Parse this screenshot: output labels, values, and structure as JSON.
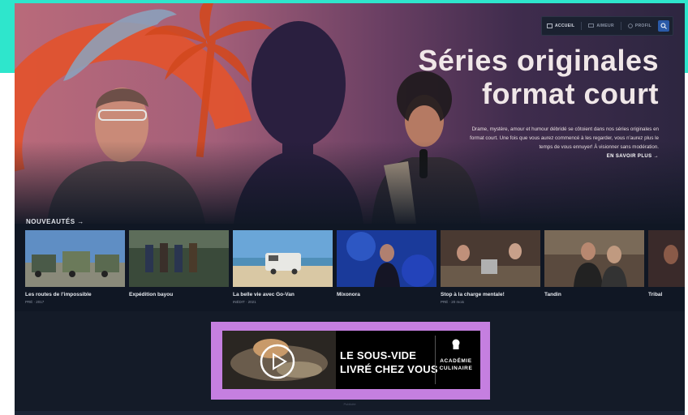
{
  "nav": {
    "items": [
      {
        "label": "ACCUEIL",
        "icon": "home-icon",
        "active": true
      },
      {
        "label": "AIMEUR",
        "icon": "tv-icon",
        "active": false
      },
      {
        "label": "PROFIL",
        "icon": "user-icon",
        "active": false
      }
    ],
    "search_icon": "search-icon"
  },
  "hero": {
    "title_line1": "Séries originales",
    "title_line2": "format court",
    "description_line1": "Drame, mystère, amour et humour débridé se côtoient dans nos séries originales en",
    "description_line2": "format court. Une fois que vous aurez commencé à les regarder, vous n’aurez plus le",
    "description_line3": "temps de vous ennuyer! À visionner sans modération.",
    "link_label": "EN SAVOIR PLUS →"
  },
  "section": {
    "label": "NOUVEAUTÉS →"
  },
  "cards": [
    {
      "title": "Les routes de l’impossible",
      "meta": "PRÉ · 2017"
    },
    {
      "title": "Expédition bayou",
      "meta": ""
    },
    {
      "title": "La belle vie avec Go-Van",
      "meta": "INÉDIT · 2021"
    },
    {
      "title": "Mixonora",
      "meta": ""
    },
    {
      "title": "Stop à la charge mentale!",
      "meta": "PRÉ · 20 mois"
    },
    {
      "title": "Tandin",
      "meta": ""
    },
    {
      "title": "Tribal",
      "meta": ""
    }
  ],
  "ad": {
    "line1": "LE SOUS-VIDE",
    "line2": "LIVRÉ CHEZ VOUS",
    "brand_line1": "ACADÉMIE",
    "brand_line2": "CULINAIRE",
    "note": "Publicité"
  },
  "colors": {
    "accent_teal": "#2ee6cc",
    "ad_frame": "#c57fe0",
    "search_blue": "#2a5aa8"
  }
}
